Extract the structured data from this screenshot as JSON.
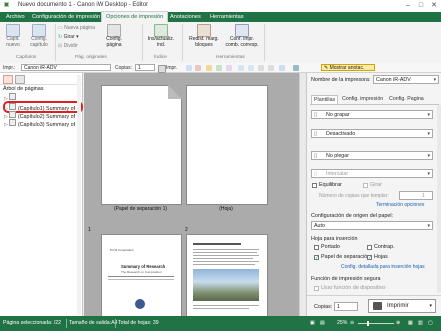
{
  "window": {
    "title": "Nuevo documento 1 - Canon iW Desktop - Editor"
  },
  "tabs": [
    "Archivo",
    "Configuración de impresión",
    "Opciones de impresión",
    "Anotaciones",
    "Herramientas"
  ],
  "ribbon": {
    "capitulo_nuevo": "Capít. nuevo",
    "config_capitulo": "Config. capítulo",
    "nueva_pagina": "Nueva página",
    "girar": "Girar",
    "dividir": "Dividir",
    "config_pagina": "Config. página",
    "insertar_marca": "Ins/actualiz. índ.",
    "redisenar": "Redist. marg. bloques",
    "conf_impr": "Conf. impr. comb. corresp.",
    "groups": {
      "capitulos": "Capítulos",
      "paginas": "Pág. originales",
      "indice": "Índice",
      "herramientas": "Herramientas"
    }
  },
  "toolbar": {
    "impr_label": "Impr.:",
    "printer": "Canon iR-ADV",
    "copies_label": "Copias:",
    "copies_value": "1",
    "impr_button": "Impr.",
    "mostrar_anotac": "Mostrar anotac."
  },
  "leftpane": {
    "title": "Árbol de páginas",
    "item1": "(Capítulo1) Summary of R",
    "item2": "(Capítulo2) Summary of R",
    "item3": "(Capítulo3) Summary of R"
  },
  "workspace": {
    "page1_caption": "(Papel de separación 1)",
    "page2_caption": "(Hoja)",
    "page3_num": "1",
    "page4_num": "2",
    "page3_title": "Summary of Research",
    "page3_sub": "The Research on Composition",
    "page3_header": "Pri-M Corporation"
  },
  "rightpane": {
    "printer_label": "Nombre de la impresora:",
    "printer_value": "Canon iR-ADV",
    "tab_plantillas": "Plantillas",
    "tab_config_impresion": "Config. impresión",
    "tab_config_pagina": "Config. Pagina",
    "staple": "No grapar",
    "offset": "Desactivado",
    "fold": "No plegar",
    "interleave": "Intercalar",
    "equilibrar": "Equilibrar",
    "girar": "Girar",
    "copias_plantilla": "Número de copias que templar:",
    "copias_value": "1",
    "terminacion_link": "Terminación opciones",
    "origen_label": "Configuración de origen del papel:",
    "origen_value": "Auto",
    "hojas_label": "Hoja para inserción",
    "portada": "Portado",
    "contrap": "Contrap.",
    "papel_sep": "Papel de separación",
    "hojas": "Hojas",
    "detallada_link": "Config. detallada para inserción hojas",
    "funcion_label": "Función de impresión segura",
    "usar_funcion": "Usar función de dispositivo",
    "copias_label": "Copias:",
    "copias_bottom": "1",
    "imprimir": "Imprimir"
  },
  "status": {
    "pagina_sel": "Página seleccionada: /22",
    "tamano": "Tamaño de salida:A4",
    "total": "Total de hojas: 39",
    "zoom": "25%"
  },
  "colors": {
    "brand_green": "#217346",
    "link_blue": "#1a5fb4",
    "highlight_red": "#e02020"
  }
}
